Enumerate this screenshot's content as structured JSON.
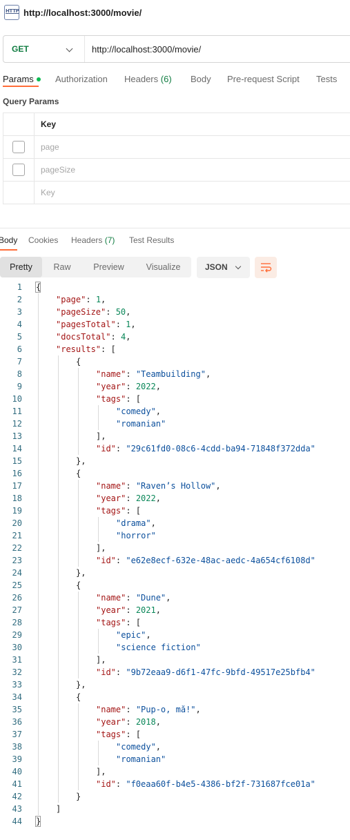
{
  "request": {
    "title": "http://localhost:3000/movie/",
    "icon": "http-icon",
    "icon_text": "HTTP",
    "method": "GET",
    "url": "http://localhost:3000/movie/"
  },
  "request_tabs": [
    {
      "label": "Params",
      "count": "",
      "active": true
    },
    {
      "label": "Authorization",
      "count": "",
      "active": false
    },
    {
      "label": "Headers",
      "count": "(6)",
      "active": false
    },
    {
      "label": "Body",
      "count": "",
      "active": false
    },
    {
      "label": "Pre-request Script",
      "count": "",
      "active": false
    },
    {
      "label": "Tests",
      "count": "",
      "active": false
    }
  ],
  "query_params": {
    "title": "Query Params",
    "header": "Key",
    "rows": [
      {
        "key": "page"
      },
      {
        "key": "pageSize"
      }
    ],
    "new_row_placeholder": "Key"
  },
  "response_tabs": [
    {
      "label": "Body",
      "count": "",
      "active": true
    },
    {
      "label": "Cookies",
      "count": "",
      "active": false
    },
    {
      "label": "Headers",
      "count": "(7)",
      "active": false
    },
    {
      "label": "Test Results",
      "count": "",
      "active": false
    }
  ],
  "view_modes": [
    "Pretty",
    "Raw",
    "Preview",
    "Visualize"
  ],
  "active_view": "Pretty",
  "format": "JSON",
  "colors": {
    "accent": "#ff6c37",
    "method": "#107c41",
    "key": "#a31515",
    "string": "#0b4f9c",
    "number": "#098658",
    "line_number": "#326d80"
  },
  "code_lines": [
    {
      "n": "1",
      "i": 0,
      "t": [
        [
          "p",
          "{"
        ]
      ]
    },
    {
      "n": "2",
      "i": 1,
      "t": [
        [
          "k",
          "\"page\""
        ],
        [
          "p",
          ": "
        ],
        [
          "n",
          "1"
        ],
        [
          "p",
          ","
        ]
      ]
    },
    {
      "n": "3",
      "i": 1,
      "t": [
        [
          "k",
          "\"pageSize\""
        ],
        [
          "p",
          ": "
        ],
        [
          "n",
          "50"
        ],
        [
          "p",
          ","
        ]
      ]
    },
    {
      "n": "4",
      "i": 1,
      "t": [
        [
          "k",
          "\"pagesTotal\""
        ],
        [
          "p",
          ": "
        ],
        [
          "n",
          "1"
        ],
        [
          "p",
          ","
        ]
      ]
    },
    {
      "n": "5",
      "i": 1,
      "t": [
        [
          "k",
          "\"docsTotal\""
        ],
        [
          "p",
          ": "
        ],
        [
          "n",
          "4"
        ],
        [
          "p",
          ","
        ]
      ]
    },
    {
      "n": "6",
      "i": 1,
      "t": [
        [
          "k",
          "\"results\""
        ],
        [
          "p",
          ": ["
        ]
      ]
    },
    {
      "n": "7",
      "i": 2,
      "t": [
        [
          "p",
          "{"
        ]
      ]
    },
    {
      "n": "8",
      "i": 3,
      "t": [
        [
          "k",
          "\"name\""
        ],
        [
          "p",
          ": "
        ],
        [
          "s",
          "\"Teambuilding\""
        ],
        [
          "p",
          ","
        ]
      ]
    },
    {
      "n": "9",
      "i": 3,
      "t": [
        [
          "k",
          "\"year\""
        ],
        [
          "p",
          ": "
        ],
        [
          "n",
          "2022"
        ],
        [
          "p",
          ","
        ]
      ]
    },
    {
      "n": "10",
      "i": 3,
      "t": [
        [
          "k",
          "\"tags\""
        ],
        [
          "p",
          ": ["
        ]
      ]
    },
    {
      "n": "11",
      "i": 4,
      "t": [
        [
          "s",
          "\"comedy\""
        ],
        [
          "p",
          ","
        ]
      ]
    },
    {
      "n": "12",
      "i": 4,
      "t": [
        [
          "s",
          "\"romanian\""
        ]
      ]
    },
    {
      "n": "13",
      "i": 3,
      "t": [
        [
          "p",
          "],"
        ]
      ]
    },
    {
      "n": "14",
      "i": 3,
      "t": [
        [
          "k",
          "\"id\""
        ],
        [
          "p",
          ": "
        ],
        [
          "s",
          "\"29c61fd0-08c6-4cdd-ba94-71848f372dda\""
        ]
      ]
    },
    {
      "n": "15",
      "i": 2,
      "t": [
        [
          "p",
          "},"
        ]
      ]
    },
    {
      "n": "16",
      "i": 2,
      "t": [
        [
          "p",
          "{"
        ]
      ]
    },
    {
      "n": "17",
      "i": 3,
      "t": [
        [
          "k",
          "\"name\""
        ],
        [
          "p",
          ": "
        ],
        [
          "s",
          "\"Raven’s Hollow\""
        ],
        [
          "p",
          ","
        ]
      ]
    },
    {
      "n": "18",
      "i": 3,
      "t": [
        [
          "k",
          "\"year\""
        ],
        [
          "p",
          ": "
        ],
        [
          "n",
          "2022"
        ],
        [
          "p",
          ","
        ]
      ]
    },
    {
      "n": "19",
      "i": 3,
      "t": [
        [
          "k",
          "\"tags\""
        ],
        [
          "p",
          ": ["
        ]
      ]
    },
    {
      "n": "20",
      "i": 4,
      "t": [
        [
          "s",
          "\"drama\""
        ],
        [
          "p",
          ","
        ]
      ]
    },
    {
      "n": "21",
      "i": 4,
      "t": [
        [
          "s",
          "\"horror\""
        ]
      ]
    },
    {
      "n": "22",
      "i": 3,
      "t": [
        [
          "p",
          "],"
        ]
      ]
    },
    {
      "n": "23",
      "i": 3,
      "t": [
        [
          "k",
          "\"id\""
        ],
        [
          "p",
          ": "
        ],
        [
          "s",
          "\"e62e8ecf-632e-48ac-aedc-4a654cf6108d\""
        ]
      ]
    },
    {
      "n": "24",
      "i": 2,
      "t": [
        [
          "p",
          "},"
        ]
      ]
    },
    {
      "n": "25",
      "i": 2,
      "t": [
        [
          "p",
          "{"
        ]
      ]
    },
    {
      "n": "26",
      "i": 3,
      "t": [
        [
          "k",
          "\"name\""
        ],
        [
          "p",
          ": "
        ],
        [
          "s",
          "\"Dune\""
        ],
        [
          "p",
          ","
        ]
      ]
    },
    {
      "n": "27",
      "i": 3,
      "t": [
        [
          "k",
          "\"year\""
        ],
        [
          "p",
          ": "
        ],
        [
          "n",
          "2021"
        ],
        [
          "p",
          ","
        ]
      ]
    },
    {
      "n": "28",
      "i": 3,
      "t": [
        [
          "k",
          "\"tags\""
        ],
        [
          "p",
          ": ["
        ]
      ]
    },
    {
      "n": "29",
      "i": 4,
      "t": [
        [
          "s",
          "\"epic\""
        ],
        [
          "p",
          ","
        ]
      ]
    },
    {
      "n": "30",
      "i": 4,
      "t": [
        [
          "s",
          "\"science fiction\""
        ]
      ]
    },
    {
      "n": "31",
      "i": 3,
      "t": [
        [
          "p",
          "],"
        ]
      ]
    },
    {
      "n": "32",
      "i": 3,
      "t": [
        [
          "k",
          "\"id\""
        ],
        [
          "p",
          ": "
        ],
        [
          "s",
          "\"9b72eaa9-d6f1-47fc-9bfd-49517e25bfb4\""
        ]
      ]
    },
    {
      "n": "33",
      "i": 2,
      "t": [
        [
          "p",
          "},"
        ]
      ]
    },
    {
      "n": "34",
      "i": 2,
      "t": [
        [
          "p",
          "{"
        ]
      ]
    },
    {
      "n": "35",
      "i": 3,
      "t": [
        [
          "k",
          "\"name\""
        ],
        [
          "p",
          ": "
        ],
        [
          "s",
          "\"Pup-o, mă!\""
        ],
        [
          "p",
          ","
        ]
      ]
    },
    {
      "n": "36",
      "i": 3,
      "t": [
        [
          "k",
          "\"year\""
        ],
        [
          "p",
          ": "
        ],
        [
          "n",
          "2018"
        ],
        [
          "p",
          ","
        ]
      ]
    },
    {
      "n": "37",
      "i": 3,
      "t": [
        [
          "k",
          "\"tags\""
        ],
        [
          "p",
          ": ["
        ]
      ]
    },
    {
      "n": "38",
      "i": 4,
      "t": [
        [
          "s",
          "\"comedy\""
        ],
        [
          "p",
          ","
        ]
      ]
    },
    {
      "n": "39",
      "i": 4,
      "t": [
        [
          "s",
          "\"romanian\""
        ]
      ]
    },
    {
      "n": "40",
      "i": 3,
      "t": [
        [
          "p",
          "],"
        ]
      ]
    },
    {
      "n": "41",
      "i": 3,
      "t": [
        [
          "k",
          "\"id\""
        ],
        [
          "p",
          ": "
        ],
        [
          "s",
          "\"f0eaa60f-b4e5-4386-bf2f-731687fce01a\""
        ]
      ]
    },
    {
      "n": "42",
      "i": 2,
      "t": [
        [
          "p",
          "}"
        ]
      ]
    },
    {
      "n": "43",
      "i": 1,
      "t": [
        [
          "p",
          "]"
        ]
      ]
    },
    {
      "n": "44",
      "i": 0,
      "t": [
        [
          "p",
          "}"
        ]
      ]
    }
  ]
}
